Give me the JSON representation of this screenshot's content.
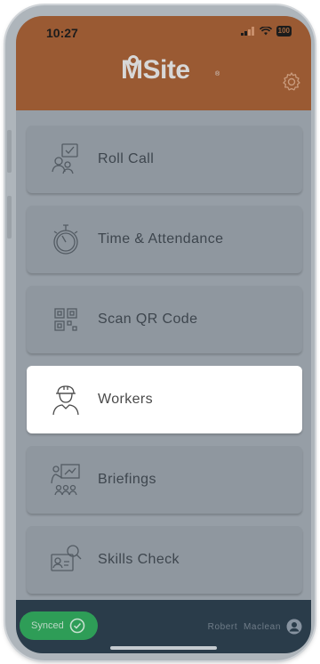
{
  "status_bar": {
    "time": "10:27",
    "battery": "100"
  },
  "header": {
    "logo_text": "MSite",
    "logo_mark": "®",
    "settings_icon": "gear-icon",
    "background_color": "#9a5a33"
  },
  "menu": {
    "items": [
      {
        "label": "Roll Call",
        "icon": "roll-call-icon"
      },
      {
        "label": "Time & Attendance",
        "icon": "stopwatch-icon"
      },
      {
        "label": "Scan QR Code",
        "icon": "qr-code-icon"
      },
      {
        "label": "Workers",
        "icon": "worker-icon",
        "selected": true
      },
      {
        "label": "Briefings",
        "icon": "briefing-icon"
      },
      {
        "label": "Skills Check",
        "icon": "skills-check-icon"
      }
    ]
  },
  "footer": {
    "sync_status": "Synced",
    "user_name": "Robert  Maclean",
    "sync_color": "#2e9d57"
  }
}
